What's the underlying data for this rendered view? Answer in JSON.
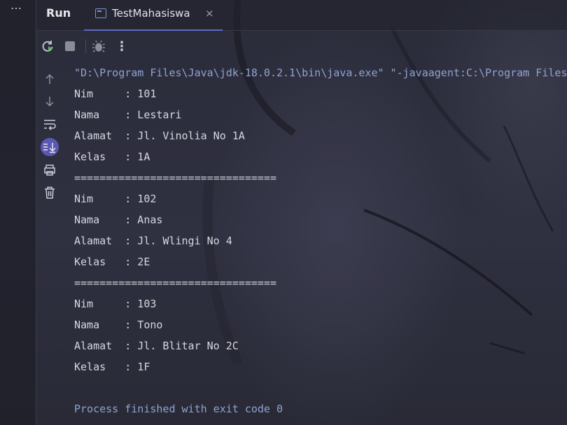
{
  "header": {
    "panel_title": "Run",
    "tab_title": "TestMahasiswa",
    "tab_close": "×",
    "more_menu": "…"
  },
  "toolbar": {
    "more_actions": "⋮"
  },
  "console": {
    "command": "\"D:\\Program Files\\Java\\jdk-18.0.2.1\\bin\\java.exe\" \"-javaagent:C:\\Program Files",
    "lines": [
      "Nim     : 101",
      "Nama    : Lestari",
      "Alamat  : Jl. Vinolia No 1A",
      "Kelas   : 1A",
      "================================",
      "Nim     : 102",
      "Nama    : Anas",
      "Alamat  : Jl. Wlingi No 4",
      "Kelas   : 2E",
      "================================",
      "Nim     : 103",
      "Nama    : Tono",
      "Alamat  : Jl. Blitar No 2C",
      "Kelas   : 1F"
    ],
    "exit_message": "Process finished with exit code 0"
  },
  "colors": {
    "accent": "#5b6bc0",
    "active_button": "#5a58b0",
    "command_text": "#8fa3cf"
  },
  "icons": {
    "rerun": "rerun-icon",
    "stop": "stop-icon",
    "debug": "debug-icon",
    "more": "more-vertical-icon",
    "up": "arrow-up-icon",
    "down": "arrow-down-icon",
    "wrap": "soft-wrap-icon",
    "scroll_end": "scroll-to-end-icon",
    "print": "print-icon",
    "clear": "trash-icon"
  }
}
